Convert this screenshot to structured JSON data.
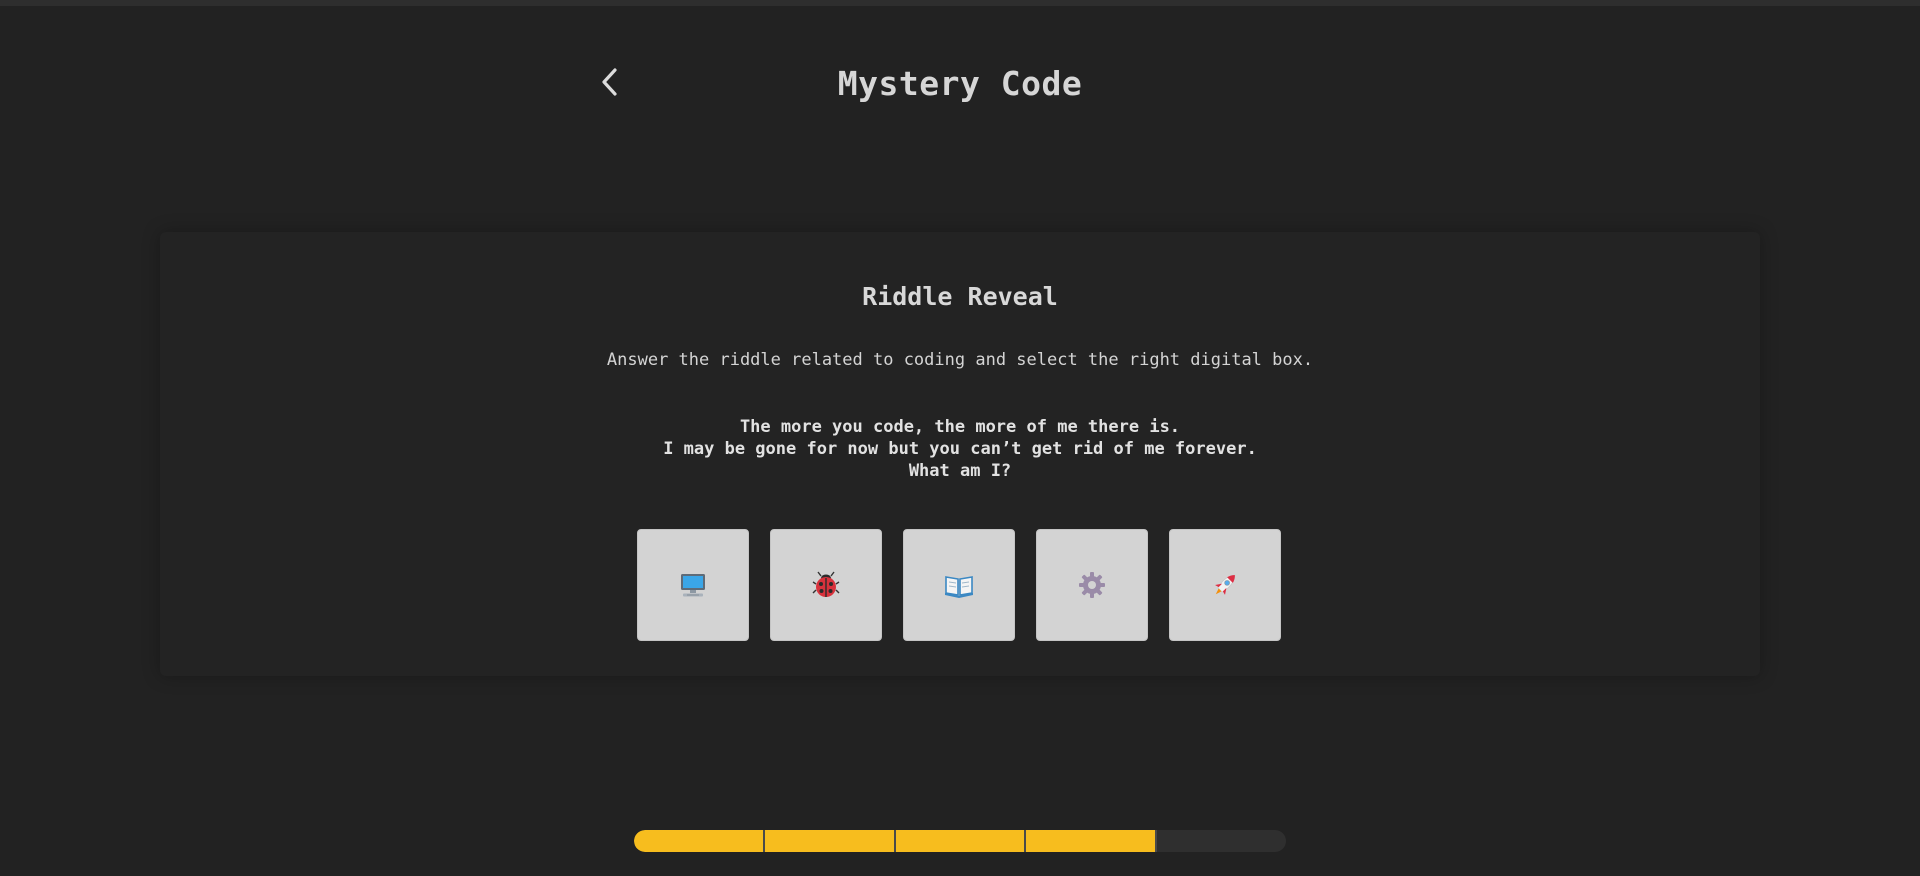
{
  "header": {
    "title": "Mystery Code",
    "back_icon": "chevron-left-icon"
  },
  "card": {
    "title": "Riddle Reveal",
    "instructions": "Answer the riddle related to coding and select the right digital box.",
    "riddle_lines": [
      "The more you code, the more of me there is.",
      "I may be gone for now but you can’t get rid of me forever.",
      "What am I?"
    ]
  },
  "options": [
    {
      "icon": "computer-icon"
    },
    {
      "icon": "ladybug-icon"
    },
    {
      "icon": "open-book-icon"
    },
    {
      "icon": "gear-icon"
    },
    {
      "icon": "rocket-icon"
    }
  ],
  "progress": {
    "completed_segments": 4,
    "total_segments": 5,
    "fill_color": "#f7bd1e",
    "track_color": "#2f2f2f"
  },
  "colors": {
    "background": "#222222",
    "option_box": "#d3d3d3",
    "accent": "#f7bd1e"
  }
}
